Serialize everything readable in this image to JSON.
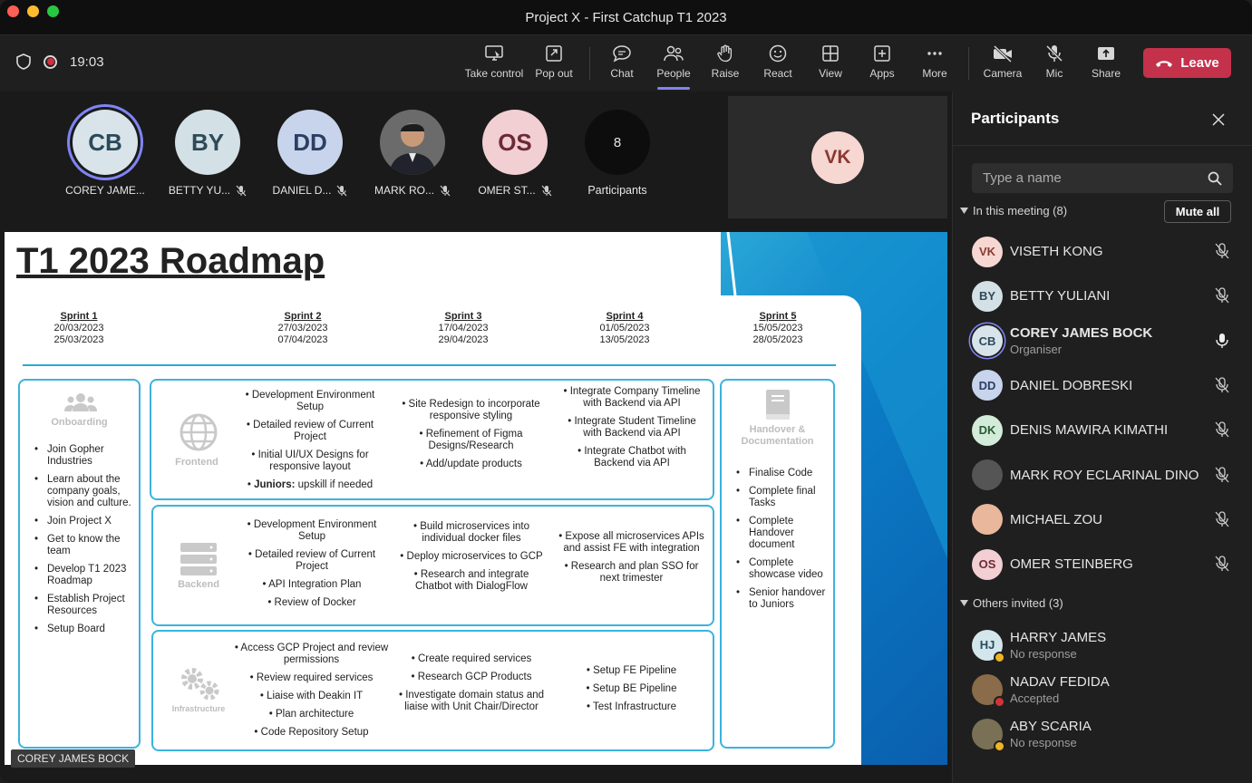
{
  "window": {
    "title": "Project X - First Catchup T1 2023"
  },
  "toolbar": {
    "timer": "19:03",
    "buttons": {
      "take_control": "Take control",
      "pop_out": "Pop out",
      "chat": "Chat",
      "people": "People",
      "raise": "Raise",
      "react": "React",
      "view": "View",
      "apps": "Apps",
      "more": "More",
      "camera": "Camera",
      "mic": "Mic",
      "share": "Share"
    },
    "leave": "Leave",
    "active_tab": "People"
  },
  "gallery": {
    "tiles": [
      {
        "initials": "CB",
        "name": "COREY JAME...",
        "speaking": true,
        "muted": false
      },
      {
        "initials": "BY",
        "name": "BETTY YU...",
        "muted": true
      },
      {
        "initials": "DD",
        "name": "DANIEL D...",
        "muted": true
      },
      {
        "initials": "",
        "name": "MARK RO...",
        "muted": true,
        "photo": true
      },
      {
        "initials": "OS",
        "name": "OMER ST...",
        "muted": true
      }
    ],
    "overflow": {
      "count": "8",
      "label": "Participants"
    },
    "self_tile": {
      "initials": "VK"
    }
  },
  "slide": {
    "title": "T1 2023 Roadmap",
    "sprints": [
      {
        "name": "Sprint 1",
        "start": "20/03/2023",
        "end": "25/03/2023"
      },
      {
        "name": "Sprint 2",
        "start": "27/03/2023",
        "end": "07/04/2023"
      },
      {
        "name": "Sprint 3",
        "start": "17/04/2023",
        "end": "29/04/2023"
      },
      {
        "name": "Sprint 4",
        "start": "01/05/2023",
        "end": "13/05/2023"
      },
      {
        "name": "Sprint 5",
        "start": "15/05/2023",
        "end": "28/05/2023"
      }
    ],
    "onboarding": {
      "label": "Onboarding",
      "items": [
        "Join Gopher Industries",
        "Learn about the company goals, vision and culture.",
        "Join Project X",
        "Get to know the team",
        "Develop T1 2023 Roadmap",
        "Establish Project Resources",
        "Setup Board"
      ]
    },
    "frontend": {
      "label": "Frontend",
      "s2": [
        "Development Environment Setup",
        "Detailed review of Current Project",
        "Initial UI/UX Designs for responsive layout",
        "upskill if needed"
      ],
      "juniors_prefix": "Juniors:",
      "s3": [
        "Site Redesign to incorporate responsive styling",
        "Refinement of Figma Designs/Research",
        "Add/update products"
      ],
      "s4": [
        "Integrate Company Timeline with Backend via API",
        "Integrate Student Timeline with Backend via API",
        "Integrate Chatbot with Backend via API"
      ]
    },
    "backend": {
      "label": "Backend",
      "s2": [
        "Development Environment Setup",
        "Detailed review of Current Project",
        "API Integration Plan",
        "Review of Docker"
      ],
      "s3": [
        "Build microservices into individual docker files",
        "Deploy microservices to GCP",
        "Research and integrate Chatbot with DialogFlow"
      ],
      "s4": [
        "Expose all microservices APIs and assist FE with integration",
        "Research and plan SSO for next trimester"
      ]
    },
    "infrastructure": {
      "label": "Infrastructure",
      "s2": [
        "Access GCP Project and review permissions",
        "Review required services",
        "Liaise with Deakin IT",
        "Plan architecture",
        "Code Repository Setup"
      ],
      "s3": [
        "Create required services",
        "Research GCP Products",
        "Investigate domain status and liaise with Unit Chair/Director"
      ],
      "s4": [
        "Setup FE Pipeline",
        "Setup BE Pipeline",
        "Test Infrastructure"
      ]
    },
    "handover": {
      "label": "Handover & Documentation",
      "items": [
        "Finalise Code",
        "Complete final Tasks",
        "Complete Handover document",
        "Complete showcase video",
        "Senior handover to Juniors"
      ]
    },
    "presenter_chip": "COREY JAMES BOCK"
  },
  "panel": {
    "title": "Participants",
    "search_placeholder": "Type a name",
    "in_meeting_label": "In this meeting (8)",
    "mute_all": "Mute all",
    "in_meeting": [
      {
        "initials": "VK",
        "name": "VISETH KONG",
        "sub": "",
        "mic": "muted"
      },
      {
        "initials": "BY",
        "name": "BETTY YULIANI",
        "sub": "",
        "mic": "muted"
      },
      {
        "initials": "CB",
        "name": "COREY JAMES BOCK",
        "sub": "Organiser",
        "mic": "on"
      },
      {
        "initials": "DD",
        "name": "DANIEL DOBRESKI",
        "sub": "",
        "mic": "muted"
      },
      {
        "initials": "DK",
        "name": "DENIS MAWIRA KIMATHI",
        "sub": "",
        "mic": "muted"
      },
      {
        "initials": "",
        "name": "MARK ROY ECLARINAL DINO",
        "sub": "",
        "mic": "muted"
      },
      {
        "initials": "",
        "name": "MICHAEL ZOU",
        "sub": "",
        "mic": "muted"
      },
      {
        "initials": "OS",
        "name": "OMER STEINBERG",
        "sub": "",
        "mic": "muted"
      }
    ],
    "others_label": "Others invited (3)",
    "others": [
      {
        "initials": "HJ",
        "name": "HARRY JAMES",
        "sub": "No response"
      },
      {
        "initials": "",
        "name": "NADAV FEDIDA",
        "sub": "Accepted"
      },
      {
        "initials": "",
        "name": "ABY SCARIA",
        "sub": "No response"
      }
    ]
  },
  "colors": {
    "leave": "#c4314b",
    "accent": "#7f85f5",
    "slide_accent": "#2aa8d8"
  }
}
